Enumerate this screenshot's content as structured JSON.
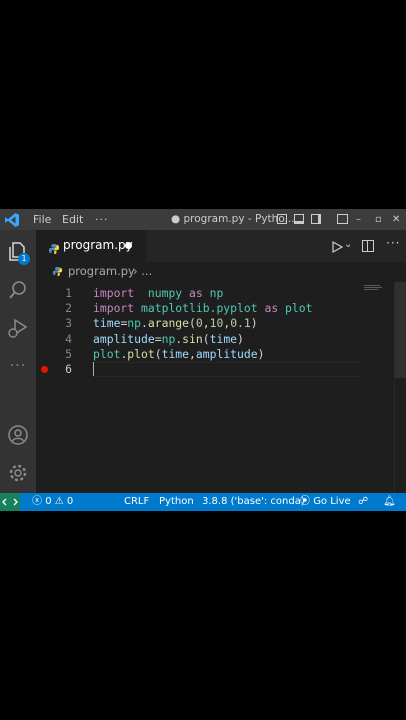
{
  "titlebar": {
    "menu": [
      "File",
      "Edit"
    ],
    "more": "···",
    "title": "● program.py - Pytho..."
  },
  "tab": {
    "label": "program.py"
  },
  "breadcrumb": {
    "file": "program.py",
    "separator": "›",
    "more": "..."
  },
  "activity": {
    "badge": "1"
  },
  "editor": {
    "lines": [
      {
        "num": "1",
        "tokens": [
          [
            "kw",
            "import"
          ],
          [
            "",
            "  "
          ],
          [
            "mod",
            "numpy"
          ],
          [
            "",
            " "
          ],
          [
            "kw",
            "as"
          ],
          [
            "",
            " "
          ],
          [
            "mod",
            "np"
          ]
        ]
      },
      {
        "num": "2",
        "tokens": [
          [
            "kw",
            "import"
          ],
          [
            "",
            " "
          ],
          [
            "mod",
            "matplotlib.pyplot"
          ],
          [
            "",
            " "
          ],
          [
            "kw",
            "as"
          ],
          [
            "",
            " "
          ],
          [
            "mod",
            "plot"
          ]
        ]
      },
      {
        "num": "3",
        "tokens": [
          [
            "var",
            "time"
          ],
          [
            "",
            "="
          ],
          [
            "mod",
            "np"
          ],
          [
            "",
            "."
          ],
          [
            "fn",
            "arange"
          ],
          [
            "",
            "("
          ],
          [
            "num",
            "0"
          ],
          [
            "",
            ","
          ],
          [
            "num",
            "10"
          ],
          [
            "",
            ","
          ],
          [
            "num",
            "0.1"
          ],
          [
            "",
            ")"
          ]
        ]
      },
      {
        "num": "4",
        "tokens": [
          [
            "var",
            "amplitude"
          ],
          [
            "",
            "="
          ],
          [
            "mod",
            "np"
          ],
          [
            "",
            "."
          ],
          [
            "fn",
            "sin"
          ],
          [
            "",
            "("
          ],
          [
            "var",
            "time"
          ],
          [
            "",
            ")"
          ]
        ]
      },
      {
        "num": "5",
        "tokens": [
          [
            "mod",
            "plot"
          ],
          [
            "",
            "."
          ],
          [
            "fn",
            "plot"
          ],
          [
            "",
            "("
          ],
          [
            "var",
            "time"
          ],
          [
            "",
            ","
          ],
          [
            "var",
            "amplitude"
          ],
          [
            "",
            ")"
          ]
        ]
      },
      {
        "num": "6",
        "tokens": []
      }
    ]
  },
  "statusbar": {
    "errors": "0",
    "warnings": "0",
    "eol": "CRLF",
    "language": "Python",
    "interpreter": "3.8.8 ('base': conda)",
    "golive": "Go Live"
  },
  "colors": {
    "status": "#007acc",
    "remote": "#16825d",
    "breakpoint": "#e51400",
    "activity_badge": "#007acc"
  }
}
